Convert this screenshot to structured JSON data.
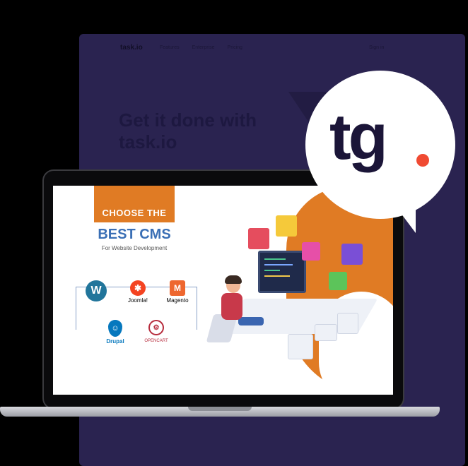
{
  "background": {
    "brand": "task.io",
    "nav_links": [
      "Features",
      "Enterprise",
      "Pricing"
    ],
    "nav_right": "Sign in",
    "headline": "Get it done with task.io",
    "color": "#2a2350"
  },
  "screen": {
    "title_line1": "CHOOSE THE",
    "title_line2": "BEST CMS",
    "title_line3": "For Website Development",
    "accent": "#e07b24",
    "cms_logos": [
      {
        "name": "wordpress-icon",
        "label": ""
      },
      {
        "name": "joomla-icon",
        "label": "Joomla!"
      },
      {
        "name": "magento-icon",
        "label": "Magento"
      },
      {
        "name": "drupal-icon",
        "label": "Drupal"
      },
      {
        "name": "opencart-icon",
        "label": "OPENCART"
      }
    ]
  },
  "badge": {
    "text": "tg",
    "dot_color": "#f04a32",
    "text_color": "#1b1538"
  }
}
